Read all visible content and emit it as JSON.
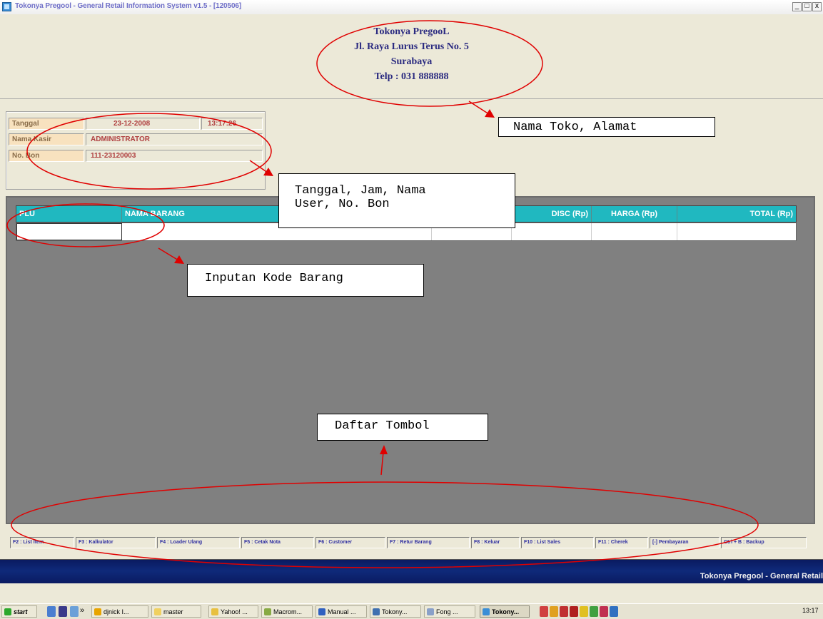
{
  "window": {
    "title": "Tokonya Pregool - General Retail Information System v1.5 - [120506]",
    "controls": {
      "minimize": "_",
      "maximize": "□",
      "close": "x"
    }
  },
  "store": {
    "name": "Tokonya PregooL",
    "address": "Jl. Raya Lurus Terus No. 5",
    "city": "Surabaya",
    "phone": "Telp : 031 888888"
  },
  "info": {
    "date_label": "Tanggal",
    "date_value": "23-12-2008",
    "time_value": "13:17:26",
    "cashier_label": "Nama Kasir",
    "cashier_value": "ADMINISTRATOR",
    "receipt_label": "No. Bon",
    "receipt_value": "111-23120003"
  },
  "grid": {
    "columns": [
      "PLU",
      "NAMA BARANG",
      "DISC (Rp)",
      "HARGA (Rp)",
      "TOTAL (Rp)"
    ]
  },
  "function_keys": [
    "F2 : List Item",
    "F3 : Kalkulator",
    "F4 : Loader Ulang",
    "F5 : Cetak Nota",
    "F6 : Customer",
    "F7 : Retur Barang",
    "F8 : Keluar",
    "F10 : List Sales",
    "F11 : Cherek",
    "[-] Pembayaran",
    "Ctrl + B : Backup"
  ],
  "status_bar": {
    "text": "Tokonya Pregool - General Retail"
  },
  "taskbar": {
    "start": "start",
    "overflow": "»",
    "items": [
      "djnick I...",
      "master",
      "Yahoo! ...",
      "Macrom...",
      "Manual ...",
      "Tokony...",
      "Fong ...",
      "Tokony..."
    ],
    "clock": "13:17"
  },
  "annotations": {
    "store": "Nama Toko, Alamat",
    "info_line1": "Tanggal, Jam, Nama",
    "info_line2": "User, No. Bon",
    "plu": "Inputan Kode Barang",
    "buttons": "Daftar Tombol"
  },
  "colors": {
    "grid_header": "#20b8c0",
    "status_bar": "#0f2a7a",
    "annotation_red": "#e00000",
    "label_bg": "#f8e2bf"
  }
}
